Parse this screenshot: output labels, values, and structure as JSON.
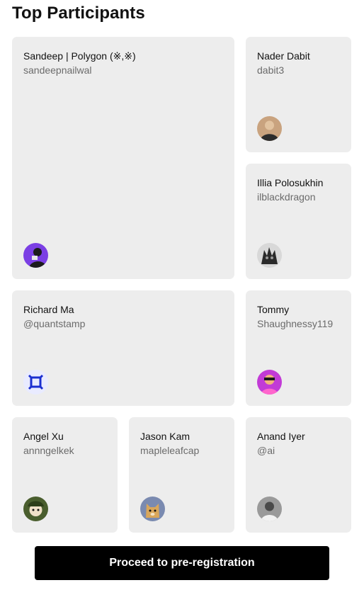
{
  "page": {
    "title": "Top Participants"
  },
  "participants": [
    {
      "name": "Sandeep | Polygon (※,※)",
      "handle": "sandeepnailwal",
      "avatar_icon": "avatar-purple-person",
      "avatar_color": "#7b3fe4"
    },
    {
      "name": "Nader Dabit",
      "handle": "dabit3",
      "avatar_icon": "avatar-person-photo",
      "avatar_color": "#c9a37f"
    },
    {
      "name": "Illia Polosukhin",
      "handle": "ilblackdragon",
      "avatar_icon": "avatar-dragon",
      "avatar_color": "#3a3a3a"
    },
    {
      "name": "Richard Ma",
      "handle": "@quantstamp",
      "avatar_icon": "avatar-quantstamp-logo",
      "avatar_color": "#1b2fd0"
    },
    {
      "name": "Tommy",
      "handle": "Shaughnessy119",
      "avatar_icon": "avatar-pink-character",
      "avatar_color": "#e84ad8"
    },
    {
      "name": "Angel Xu",
      "handle": "annngelkek",
      "avatar_icon": "avatar-green-cartoon",
      "avatar_color": "#5a7a3a"
    },
    {
      "name": "Jason Kam",
      "handle": "mapleleafcap",
      "avatar_icon": "avatar-doge",
      "avatar_color": "#d9a65a"
    },
    {
      "name": "Anand Iyer",
      "handle": "@ai",
      "avatar_icon": "avatar-person-bw",
      "avatar_color": "#8a8a8a"
    }
  ],
  "cta": {
    "label": "Proceed to pre-registration"
  }
}
